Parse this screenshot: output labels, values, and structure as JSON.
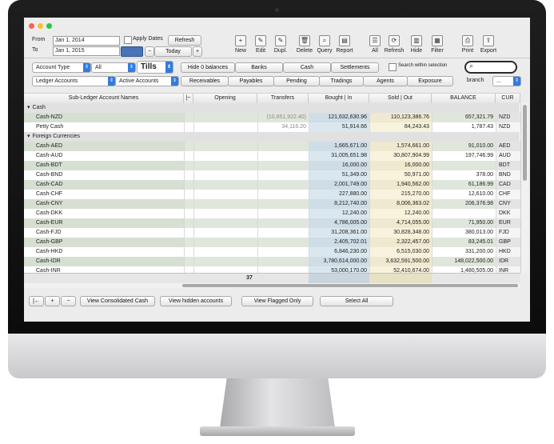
{
  "toolbar": {
    "from_label": "From",
    "to_label": "To",
    "from_date": "Jan 1, 2014",
    "to_date": "Jan 1, 2015",
    "apply_dates_label": "Apply Dates",
    "refresh_label": "Refresh",
    "today_label": "Today",
    "minus_label": "−",
    "plus_label": "+",
    "tools": [
      {
        "label": "New",
        "icon": "plus-icon",
        "glyph": "+"
      },
      {
        "label": "Edit",
        "icon": "pencil-icon",
        "glyph": "✎"
      },
      {
        "label": "Dupl.",
        "icon": "duplicate-icon",
        "glyph": "✎"
      },
      {
        "label": "Delete",
        "icon": "trash-icon",
        "glyph": "🗑"
      },
      {
        "label": "Query",
        "icon": "magnifier-icon",
        "glyph": "⌕"
      },
      {
        "label": "Report",
        "icon": "report-icon",
        "glyph": "▤"
      },
      {
        "label": "All",
        "icon": "list-icon",
        "glyph": "☰"
      },
      {
        "label": "Refresh",
        "icon": "refresh-icon",
        "glyph": "⟳"
      },
      {
        "label": "Hide",
        "icon": "hide-icon",
        "glyph": "▥"
      },
      {
        "label": "Filter",
        "icon": "filter-icon",
        "glyph": "▦"
      },
      {
        "label": "Print",
        "icon": "printer-icon",
        "glyph": "⎙"
      },
      {
        "label": "Export",
        "icon": "export-icon",
        "glyph": "⇪"
      }
    ]
  },
  "filters": {
    "account_type": "Account Type",
    "all": "All",
    "tills": "Tills",
    "ledger_accounts": "Ledger Accounts",
    "active_accounts": "Active Accounts",
    "search_within_selection": "Search within selection",
    "branch_label": "branch",
    "branch_value": "...",
    "tabs_row1": [
      "Hide 0 balances",
      "Banks",
      "Cash",
      "Settlements"
    ],
    "tabs_row2": [
      "Receivables",
      "Payables",
      "Pending",
      "Tradings",
      "Agents",
      "Exposure"
    ]
  },
  "columns": [
    "Sub-Ledger Account Names",
    "|~",
    "Opening",
    "Transfers",
    "Bought | In",
    "Sold | Out",
    "BALANCE",
    "CUR"
  ],
  "groups": [
    {
      "name": "Cash",
      "rows": [
        {
          "name": "Cash-NZD",
          "opening": "",
          "transfers": "(10,851,922.40)",
          "bought": "121,632,630.96",
          "sold": "110,123,386.76",
          "balance": "657,321.79",
          "cur": "NZD"
        },
        {
          "name": "Petty Cash",
          "opening": "",
          "transfers": "34,116.20",
          "bought": "51,914.66",
          "sold": "84,243.43",
          "balance": "1,787.43",
          "cur": "NZD"
        }
      ]
    },
    {
      "name": "Foreign Currencies",
      "rows": [
        {
          "name": "Cash-AED",
          "opening": "",
          "transfers": "",
          "bought": "1,665,671.00",
          "sold": "1,574,661.00",
          "balance": "91,010.00",
          "cur": "AED"
        },
        {
          "name": "Cash-AUD",
          "opening": "",
          "transfers": "",
          "bought": "31,005,651.98",
          "sold": "30,807,904.99",
          "balance": "197,746.99",
          "cur": "AUD"
        },
        {
          "name": "Cash-BDT",
          "opening": "",
          "transfers": "",
          "bought": "16,000.00",
          "sold": "16,000.00",
          "balance": "",
          "cur": "BDT"
        },
        {
          "name": "Cash-BND",
          "opening": "",
          "transfers": "",
          "bought": "51,349.00",
          "sold": "50,971.00",
          "balance": "378.00",
          "cur": "BND"
        },
        {
          "name": "Cash-CAD",
          "opening": "",
          "transfers": "",
          "bought": "2,001,749.00",
          "sold": "1,940,562.00",
          "balance": "61,186.99",
          "cur": "CAD"
        },
        {
          "name": "Cash-CHF",
          "opening": "",
          "transfers": "",
          "bought": "227,880.00",
          "sold": "215,270.00",
          "balance": "12,610.00",
          "cur": "CHF"
        },
        {
          "name": "Cash-CNY",
          "opening": "",
          "transfers": "",
          "bought": "8,212,740.00",
          "sold": "8,006,363.02",
          "balance": "206,376.98",
          "cur": "CNY"
        },
        {
          "name": "Cash-DKK",
          "opening": "",
          "transfers": "",
          "bought": "12,240.00",
          "sold": "12,240.00",
          "balance": "",
          "cur": "DKK"
        },
        {
          "name": "Cash-EUR",
          "opening": "",
          "transfers": "",
          "bought": "4,786,005.00",
          "sold": "4,714,055.00",
          "balance": "71,950.00",
          "cur": "EUR"
        },
        {
          "name": "Cash-FJD",
          "opening": "",
          "transfers": "",
          "bought": "31,208,361.00",
          "sold": "30,828,348.00",
          "balance": "380,013.00",
          "cur": "FJD"
        },
        {
          "name": "Cash-GBP",
          "opening": "",
          "transfers": "",
          "bought": "2,405,702.01",
          "sold": "2,322,457.00",
          "balance": "83,245.01",
          "cur": "GBP"
        },
        {
          "name": "Cash-HKD",
          "opening": "",
          "transfers": "",
          "bought": "6,846,230.00",
          "sold": "6,515,030.00",
          "balance": "331,200.00",
          "cur": "HKD"
        },
        {
          "name": "Cash-IDR",
          "opening": "",
          "transfers": "",
          "bought": "3,780,614,000.00",
          "sold": "3,632,591,500.00",
          "balance": "148,022,500.00",
          "cur": "IDR"
        },
        {
          "name": "Cash-INR",
          "opening": "",
          "transfers": "",
          "bought": "53,000,170.00",
          "sold": "52,410,674.00",
          "balance": "1,480,505.00",
          "cur": "INR"
        }
      ]
    }
  ],
  "footer": {
    "count": "37",
    "nav_labels": [
      "|←",
      "+",
      "−"
    ],
    "buttons": [
      "View Consolidated Cash",
      "View hidden accounts",
      "View Flagged Only",
      "Select All"
    ]
  },
  "colors": {
    "row_highlight": "#dfe6dc",
    "bought_bg": "#d8e6ef",
    "sold_bg": "#f7f1d6",
    "selected_tab": "#2f7de1"
  }
}
